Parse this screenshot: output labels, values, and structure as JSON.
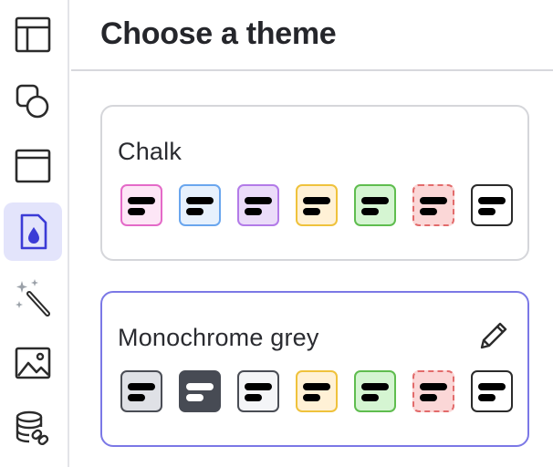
{
  "header": {
    "title": "Choose a theme"
  },
  "sidebar": {
    "items": [
      {
        "name": "layout-icon",
        "active": false
      },
      {
        "name": "shapes-icon",
        "active": false
      },
      {
        "name": "window-icon",
        "active": false
      },
      {
        "name": "theme-drop-icon",
        "active": true
      },
      {
        "name": "magic-wand-icon",
        "active": false
      },
      {
        "name": "image-icon",
        "active": false
      },
      {
        "name": "database-link-icon",
        "active": false
      }
    ]
  },
  "themes": [
    {
      "name": "Chalk",
      "selected": false,
      "editable": false,
      "swatches": [
        {
          "bg": "#fde6f6",
          "border": "#e46ac8",
          "line": "#000000",
          "dashed": false
        },
        {
          "bg": "#e7f1fd",
          "border": "#6aa6ee",
          "line": "#000000",
          "dashed": false
        },
        {
          "bg": "#ebdcf9",
          "border": "#b37be8",
          "line": "#000000",
          "dashed": false
        },
        {
          "bg": "#fff1d6",
          "border": "#efc23c",
          "line": "#000000",
          "dashed": false
        },
        {
          "bg": "#d5f5d2",
          "border": "#5fbd4f",
          "line": "#000000",
          "dashed": false
        },
        {
          "bg": "#fbd7d7",
          "border": "#e26b6b",
          "line": "#000000",
          "dashed": true
        },
        {
          "bg": "#ffffff",
          "border": "#2b2b2b",
          "line": "#000000",
          "dashed": false
        }
      ]
    },
    {
      "name": "Monochrome grey",
      "selected": true,
      "editable": true,
      "swatches": [
        {
          "bg": "#dfe1e6",
          "border": "#4a4d55",
          "line": "#000000",
          "dashed": false
        },
        {
          "bg": "#474b54",
          "border": "#474b54",
          "line": "#ffffff",
          "dashed": false
        },
        {
          "bg": "#f4f5f7",
          "border": "#4a4d55",
          "line": "#000000",
          "dashed": false
        },
        {
          "bg": "#fff1d6",
          "border": "#efc23c",
          "line": "#000000",
          "dashed": false
        },
        {
          "bg": "#d5f5d2",
          "border": "#5fbd4f",
          "line": "#000000",
          "dashed": false
        },
        {
          "bg": "#fbd7d7",
          "border": "#e26b6b",
          "line": "#000000",
          "dashed": true
        },
        {
          "bg": "#ffffff",
          "border": "#2b2b2b",
          "line": "#000000",
          "dashed": false
        }
      ]
    }
  ],
  "colors": {
    "accent": "#7b78e6",
    "active_nav_bg": "#e3e4fb",
    "active_nav_icon": "#3b3bd6"
  }
}
